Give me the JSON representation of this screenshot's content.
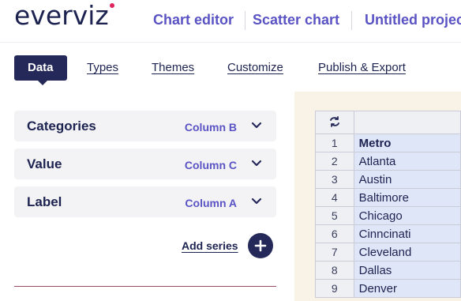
{
  "header": {
    "logo": "everviz",
    "breadcrumbs": [
      "Chart editor",
      "Scatter chart",
      "Untitled project"
    ]
  },
  "tabs": [
    {
      "label": "Data",
      "active": true
    },
    {
      "label": "Types",
      "active": false
    },
    {
      "label": "Themes",
      "active": false
    },
    {
      "label": "Customize",
      "active": false
    },
    {
      "label": "Publish & Export",
      "active": false
    }
  ],
  "mapping": [
    {
      "label": "Categories",
      "value": "Column B"
    },
    {
      "label": "Value",
      "value": "Column C"
    },
    {
      "label": "Label",
      "value": "Column A"
    }
  ],
  "add_series_label": "Add series",
  "grid": {
    "header_icon": "refresh-icon",
    "rows": [
      {
        "num": "1",
        "value": "Metro"
      },
      {
        "num": "2",
        "value": "Atlanta"
      },
      {
        "num": "3",
        "value": "Austin"
      },
      {
        "num": "4",
        "value": "Baltimore"
      },
      {
        "num": "5",
        "value": "Chicago"
      },
      {
        "num": "6",
        "value": "Cinncinati"
      },
      {
        "num": "7",
        "value": "Cleveland"
      },
      {
        "num": "8",
        "value": "Dallas"
      },
      {
        "num": "9",
        "value": "Denver"
      }
    ]
  },
  "colors": {
    "brand": "#25295a",
    "accent": "#5a53c4",
    "logo_dot": "#e0245e"
  }
}
